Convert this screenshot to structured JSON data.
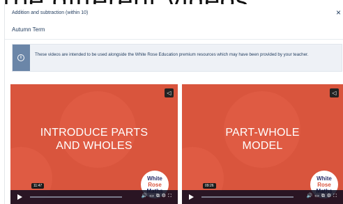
{
  "background": {
    "title": "the different videos."
  },
  "modal": {
    "breadcrumb": "Addition and subtraction (within 10)",
    "close_icon": "×",
    "term": "Autumn Term"
  },
  "info": {
    "icon": "i",
    "text": "These videos are intended to be used alongside the White Rose Education premium resources which may have been provided by your teacher."
  },
  "videos": [
    {
      "title_line1": "INTRODUCE PARTS",
      "title_line2": "AND WHOLES",
      "time": "11:47",
      "logo": [
        "White",
        "Rose",
        "Maths"
      ]
    },
    {
      "title_line1": "PART-WHOLE",
      "title_line2": "MODEL",
      "time": "09:26",
      "logo": [
        "White",
        "Rose",
        "Maths"
      ]
    }
  ],
  "colors": {
    "video_bg": "#d9553d",
    "navy": "#1f3a5c",
    "banner_stripe": "#6b86a8"
  }
}
